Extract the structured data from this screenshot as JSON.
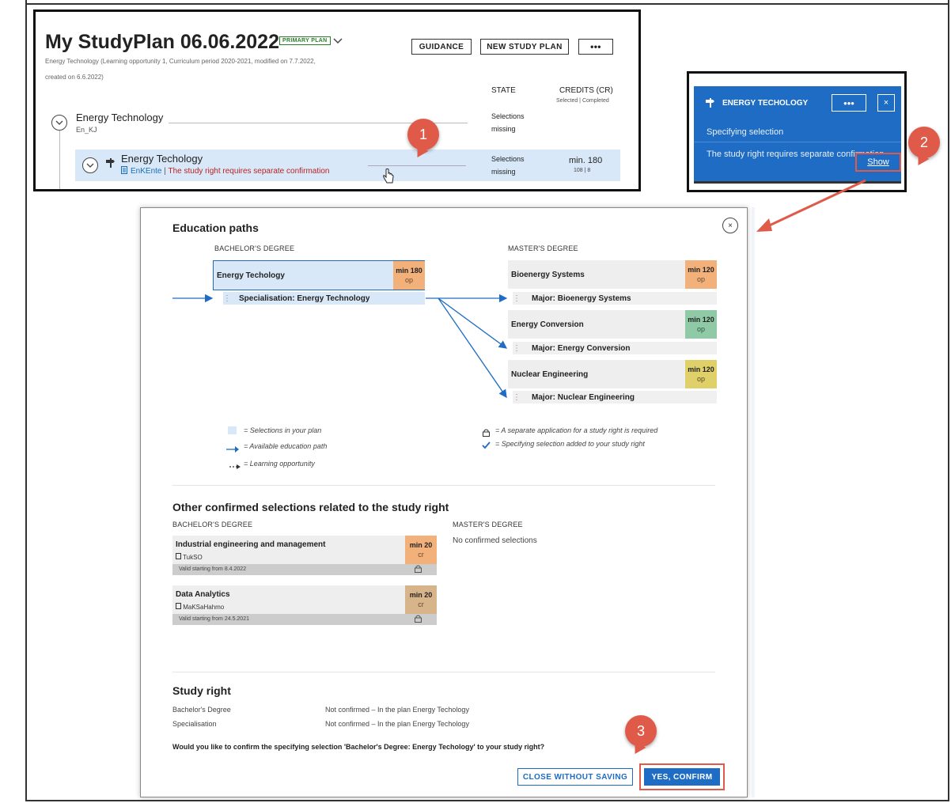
{
  "plan": {
    "title": "My StudyPlan 06.06.2022",
    "badge": "PRIMARY PLAN",
    "meta_line1": "Energy Technology (Learning opportunity 1, Curriculum period 2020-2021, modified on 7.7.2022,",
    "meta_line2": "created on 6.6.2022)",
    "buttons": {
      "guidance": "GUIDANCE",
      "new_plan": "NEW STUDY PLAN",
      "more": "•••"
    },
    "headers": {
      "state": "STATE",
      "credits": "CREDITS (CR)",
      "credits_sub": "Selected | Completed"
    },
    "row1": {
      "name": "Energy Technology",
      "code": "En_KJ",
      "state_line1": "Selections",
      "state_line2": "missing"
    },
    "row2": {
      "name": "Energy Techology",
      "code": "EnKEnte",
      "separator": "|",
      "warning": "The study right requires separate confirmation",
      "state_line1": "Selections",
      "state_line2": "missing",
      "credits": "min. 180",
      "credits_sub": "108 | 8"
    }
  },
  "callouts": {
    "one": "1",
    "two": "2",
    "three": "3"
  },
  "side_panel": {
    "title": "ENERGY TECHOLOGY",
    "more": "•••",
    "close": "×",
    "line1": "Specifying selection",
    "line2": "The study right requires separate confirmation",
    "show": "Show"
  },
  "modal": {
    "title": "Education paths",
    "close": "×",
    "bachelor_caption": "BACHELOR'S DEGREE",
    "master_caption": "MASTER'S DEGREE",
    "bachelor": {
      "name": "Energy Techology",
      "tag": "min 180",
      "unit": "op",
      "spec": "Specialisation: Energy Technology",
      "tag_color": "#f2b07a"
    },
    "masters": [
      {
        "name": "Bioenergy Systems",
        "tag": "min 120",
        "unit": "op",
        "major": "Major: Bioenergy Systems",
        "tag_color": "#f2b07a"
      },
      {
        "name": "Energy Conversion",
        "tag": "min 120",
        "unit": "op",
        "major": "Major: Energy Conversion",
        "tag_color": "#8fc9a6"
      },
      {
        "name": "Nuclear Engineering",
        "tag": "min 120",
        "unit": "op",
        "major": "Major: Nuclear Engineering",
        "tag_color": "#e0d06a"
      }
    ],
    "legend": {
      "selections": "= Selections in your plan",
      "available": "= Available education path",
      "learning": "= Learning opportunity",
      "separate": "= A separate application for a study right is required",
      "specifying": "= Specifying selection added to your study right"
    },
    "other_title": "Other confirmed selections related to the study right",
    "other_bachelor_caption": "BACHELOR'S DEGREE",
    "other_master_caption": "MASTER'S DEGREE",
    "no_confirmed": "No confirmed selections",
    "cards": [
      {
        "title": "Industrial engineering and management",
        "code": "TukSO",
        "tag": "min 20",
        "unit": "cr",
        "valid": "Valid starting from 8.4.2022",
        "tag_color": "#f2b07a"
      },
      {
        "title": "Data Analytics",
        "code": "MaKSaHahmo",
        "tag": "min 20",
        "unit": "cr",
        "valid": "Valid starting from 24.5.2021",
        "tag_color": "#d8b48a"
      }
    ],
    "study_right_title": "Study right",
    "study_right_rows": [
      {
        "label": "Bachelor's Degree",
        "value": "Not confirmed – In the plan Energy Techology"
      },
      {
        "label": "Specialisation",
        "value": "Not confirmed – In the plan Energy Techology"
      }
    ],
    "question": "Would you like to confirm the specifying selection 'Bachelor's Degree: Energy Techology' to your study right?",
    "btn_cancel": "CLOSE WITHOUT SAVING",
    "btn_confirm": "YES, CONFIRM"
  },
  "colors": {
    "accent": "#1e6cc4",
    "callout": "#e05a4a",
    "selection": "#d8e8f8"
  }
}
